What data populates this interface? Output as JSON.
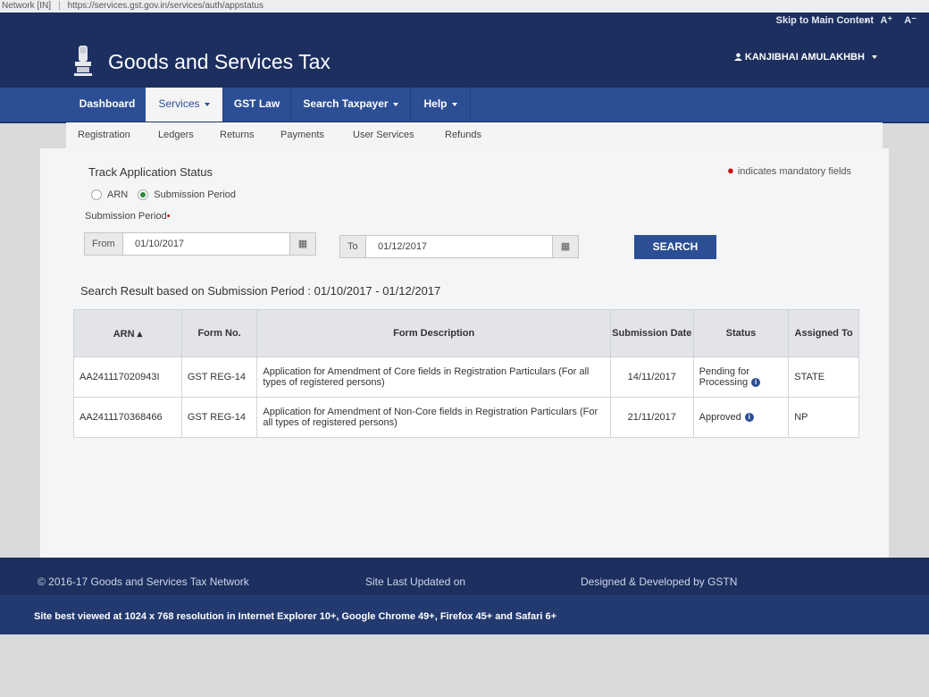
{
  "browser": {
    "network_label": "Network [IN]",
    "url": "https://services.gst.gov.in/services/auth/appstatus"
  },
  "header": {
    "skip_link": "Skip to Main Content",
    "a11y": {
      "contrast": "◑",
      "font_plus": "A⁺",
      "font_minus": "A⁻"
    },
    "title": "Goods and Services Tax",
    "user_name": "KANJIBHAI AMULAKHBH",
    "user_icon": "user-icon"
  },
  "main_nav": {
    "items": [
      "Dashboard",
      "Services",
      "GST Law",
      "Search Taxpayer",
      "Help"
    ],
    "active": "Services"
  },
  "sub_nav": {
    "items": [
      "Registration",
      "Ledgers",
      "Returns",
      "Payments",
      "User Services",
      "Refunds"
    ]
  },
  "form": {
    "title": "Track Application Status",
    "mandatory_note": "indicates mandatory fields",
    "radio_options": [
      "ARN",
      "Submission Period"
    ],
    "selected_option": "Submission Period",
    "period_label": "Submission Period",
    "from_label": "From",
    "from_value": "01/10/2017",
    "to_label": "To",
    "to_value": "01/12/2017",
    "search_label": "SEARCH"
  },
  "results": {
    "summary": "Search Result based on Submission Period : 01/10/2017 - 01/12/2017",
    "columns": [
      "ARN",
      "Form No.",
      "Form Description",
      "Submission Date",
      "Status",
      "Assigned To"
    ],
    "rows": [
      {
        "arn": "AA241117020943I",
        "form_no": "GST REG-14",
        "description": "Application for Amendment of Core fields in Registration Particulars (For all types of registered persons)",
        "date": "14/11/2017",
        "status": "Pending for Processing",
        "assigned": "STATE"
      },
      {
        "arn": "AA2411170368466",
        "form_no": "GST REG-14",
        "description": "Application for Amendment of Non-Core fields in Registration Particulars (For all types of registered persons)",
        "date": "21/11/2017",
        "status": "Approved",
        "assigned": "NP"
      }
    ]
  },
  "footer": {
    "copyright": "© 2016-17 Goods and Services Tax Network",
    "last_updated": "Site Last Updated on",
    "designed_by": "Designed & Developed by GSTN",
    "best_viewed": "Site best viewed at 1024 x 768 resolution in Internet Explorer 10+, Google Chrome 49+, Firefox 45+ and Safari 6+"
  },
  "colors": {
    "header_bg": "#1c2f5f",
    "nav_bg": "#2c4e95",
    "mandatory_dot": "#cc1111",
    "radio_selected": "#2a8a3a"
  }
}
